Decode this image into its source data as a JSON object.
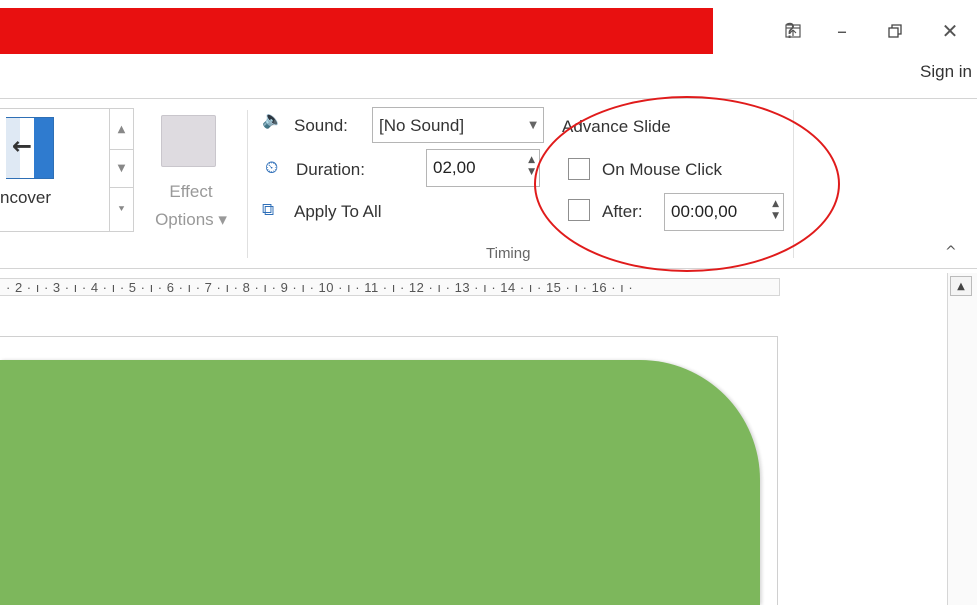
{
  "colors": {
    "title_bar": "#e81010",
    "slide_shape": "#7db75c",
    "annotation": "#e01b1b"
  },
  "window": {
    "help_label": "?",
    "restore_ribbon_icon": "ribbon-display-icon",
    "minimize_label": "–",
    "restore_label": "🗗",
    "close_label": "✕",
    "sign_in": "Sign in"
  },
  "ribbon": {
    "gallery": {
      "visible_label": "ncover",
      "scroll_up": "▲",
      "scroll_down": "▼",
      "more": "⯆"
    },
    "effect_options": {
      "label_line1": "Effect",
      "label_line2": "Options ▾"
    },
    "timing": {
      "sound_label": "Sound:",
      "sound_value": "[No Sound]",
      "duration_label": "Duration:",
      "duration_value": "02,00",
      "apply_all_label": "Apply To All",
      "advance_heading": "Advance Slide",
      "on_mouse_click_label": "On Mouse Click",
      "after_label": "After:",
      "after_value": "00:00,00",
      "group_label": "Timing"
    },
    "collapse_label": "^"
  },
  "ruler": {
    "text": "· 2 · ı · 3 · ı · 4 · ı · 5 · ı · 6 · ı · 7 · ı · 8 · ı · 9 · ı · 10 · ı · 11 · ı · 12 · ı · 13 · ı · 14 · ı · 15 · ı · 16 · ı ·"
  }
}
